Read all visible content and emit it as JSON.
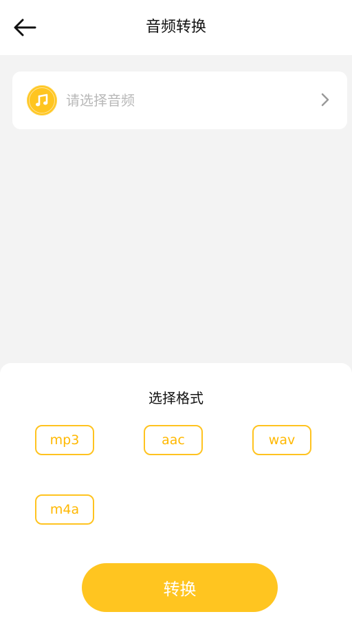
{
  "header": {
    "title": "音频转换"
  },
  "picker": {
    "placeholder": "请选择音频",
    "icon": "music-note-icon"
  },
  "format_sheet": {
    "title": "选择格式",
    "formats": [
      "mp3",
      "aac",
      "wav",
      "m4a"
    ]
  },
  "convert_button": {
    "label": "转换"
  },
  "colors": {
    "accent": "#ffc520",
    "accent_text": "#ffb800",
    "background": "#f3f3f3",
    "placeholder": "#b8b8b8"
  }
}
